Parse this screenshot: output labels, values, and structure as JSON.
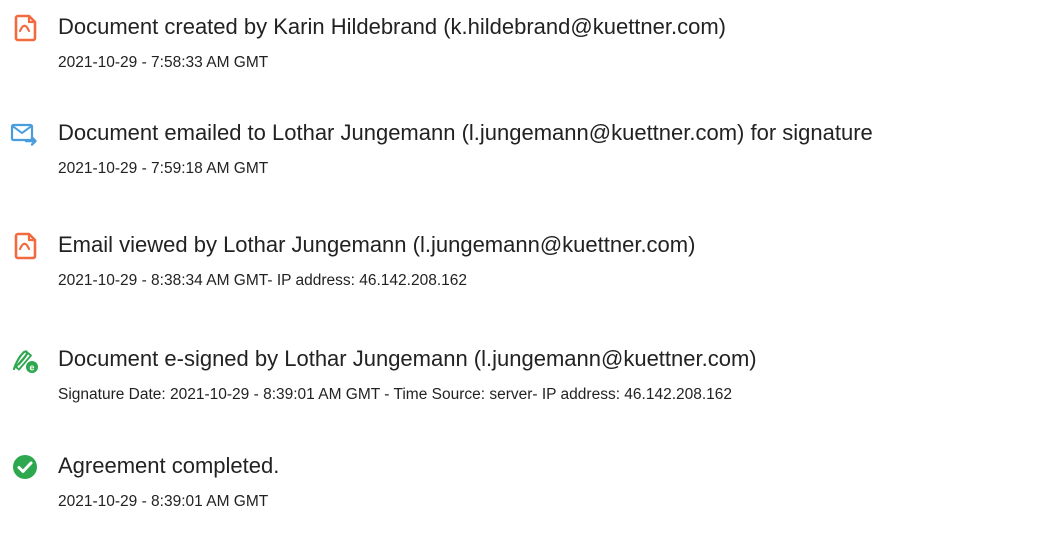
{
  "theme": {
    "accent_orange": "#f26a3f",
    "accent_blue": "#4a9ddc",
    "accent_green": "#2da84f",
    "text": "#222222"
  },
  "events": [
    {
      "icon": "document-created-icon",
      "title": "Document created by Karin Hildebrand (k.hildebrand@kuettner.com)",
      "detail": "2021-10-29 - 7:58:33 AM GMT"
    },
    {
      "icon": "email-sent-icon",
      "title": "Document emailed to Lothar Jungemann (l.jungemann@kuettner.com) for signature",
      "detail": "2021-10-29 - 7:59:18 AM GMT"
    },
    {
      "icon": "email-viewed-icon",
      "title": "Email viewed by Lothar Jungemann (l.jungemann@kuettner.com)",
      "detail": "2021-10-29 - 8:38:34 AM GMT- IP address: 46.142.208.162"
    },
    {
      "icon": "e-signed-icon",
      "title": "Document e-signed by Lothar Jungemann (l.jungemann@kuettner.com)",
      "detail": "Signature Date: 2021-10-29 - 8:39:01 AM GMT - Time Source: server- IP address: 46.142.208.162"
    },
    {
      "icon": "completed-check-icon",
      "title": "Agreement completed.",
      "detail": "2021-10-29 - 8:39:01 AM GMT"
    }
  ]
}
